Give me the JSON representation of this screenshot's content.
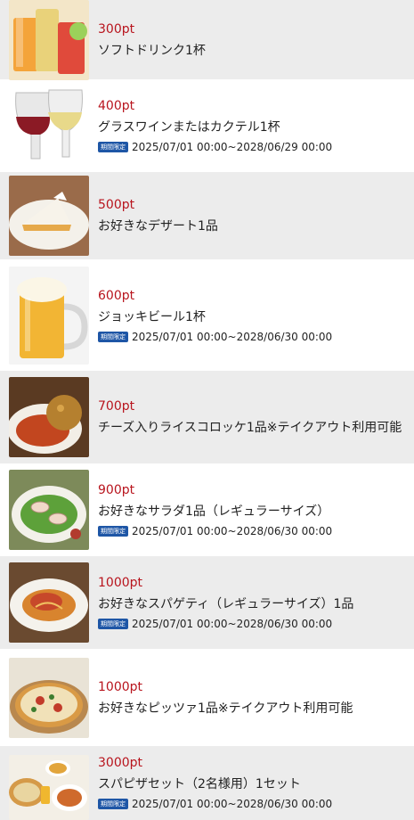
{
  "badge_label": "期間限定",
  "items": [
    {
      "points": "300pt",
      "name": "ソフトドリンク1杯",
      "period": "",
      "image": "soft-drink-photo"
    },
    {
      "points": "400pt",
      "name": "グラスワインまたはカクテル1杯",
      "period": "2025/07/01 00:00~2028/06/29 00:00",
      "image": "wine-glasses-photo"
    },
    {
      "points": "500pt",
      "name": "お好きなデザート1品",
      "period": "",
      "image": "dessert-pie-photo"
    },
    {
      "points": "600pt",
      "name": "ジョッキビール1杯",
      "period": "2025/07/01 00:00~2028/06/30 00:00",
      "image": "beer-mug-photo"
    },
    {
      "points": "700pt",
      "name": "チーズ入りライスコロッケ1品※テイクアウト利用可能",
      "period": "",
      "image": "rice-croquette-photo"
    },
    {
      "points": "900pt",
      "name": "お好きなサラダ1品（レギュラーサイズ）",
      "period": "2025/07/01 00:00~2028/06/30 00:00",
      "image": "salad-photo"
    },
    {
      "points": "1000pt",
      "name": "お好きなスパゲティ（レギュラーサイズ）1品",
      "period": "2025/07/01 00:00~2028/06/30 00:00",
      "image": "spaghetti-photo"
    },
    {
      "points": "1000pt",
      "name": "お好きなピッツァ1品※テイクアウト利用可能",
      "period": "",
      "image": "pizza-photo"
    },
    {
      "points": "3000pt",
      "name": "スパピザセット（2名様用）1セット",
      "period": "2025/07/01 00:00~2028/06/30 00:00",
      "image": "set-meal-photo"
    }
  ]
}
